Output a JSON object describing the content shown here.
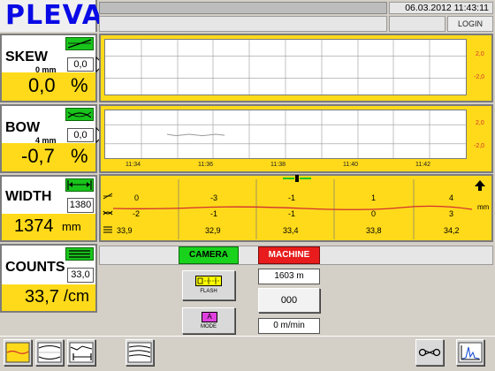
{
  "header": {
    "logo": "PLEVA",
    "datetime": "06.03.2012 11:43:11",
    "login_label": "LOGIN"
  },
  "skew": {
    "title": "SKEW",
    "unit_sub": "0 mm",
    "input_value": "0,0",
    "value": "0,0",
    "unit": "%",
    "scale_hi": "2,0",
    "scale_lo": "-2,0"
  },
  "bow": {
    "title": "BOW",
    "unit_sub": "4 mm",
    "input_value": "0,0",
    "value": "-0,7",
    "unit": "%",
    "scale_hi": "2,0",
    "scale_lo": "-2,0"
  },
  "time_axis": [
    "11:34",
    "11:36",
    "11:38",
    "11:40",
    "11:42"
  ],
  "width": {
    "title": "WIDTH",
    "input_value": "1380",
    "value": "1374",
    "unit": "mm",
    "table_unit": "mm",
    "rows": [
      [
        "0",
        "-3",
        "-1",
        "1",
        "4"
      ],
      [
        "-2",
        "-1",
        "-1",
        "0",
        "3"
      ],
      [
        "33,9",
        "32,9",
        "33,4",
        "33,8",
        "34,2"
      ]
    ]
  },
  "counts": {
    "title": "COUNTS",
    "input_value": "33,0",
    "value": "33,7",
    "unit": "/cm"
  },
  "status": {
    "camera_label": "CAMERA",
    "camera_color": "#19d21c",
    "machine_label": "MACHINE",
    "machine_color": "#e81c1c"
  },
  "controls": {
    "flash_label": "FLASH",
    "mode_label": "MODE",
    "mode_letter": "A",
    "length_value": "1603 m",
    "counter_value": "000",
    "speed_value": "0 m/min"
  },
  "icons": {
    "toolbar": [
      "skew-chart-icon",
      "bow-chart-icon",
      "width-chart-icon",
      "multi-chart-icon"
    ],
    "right": [
      "scissors-icon",
      "spectrum-chart-icon"
    ]
  }
}
